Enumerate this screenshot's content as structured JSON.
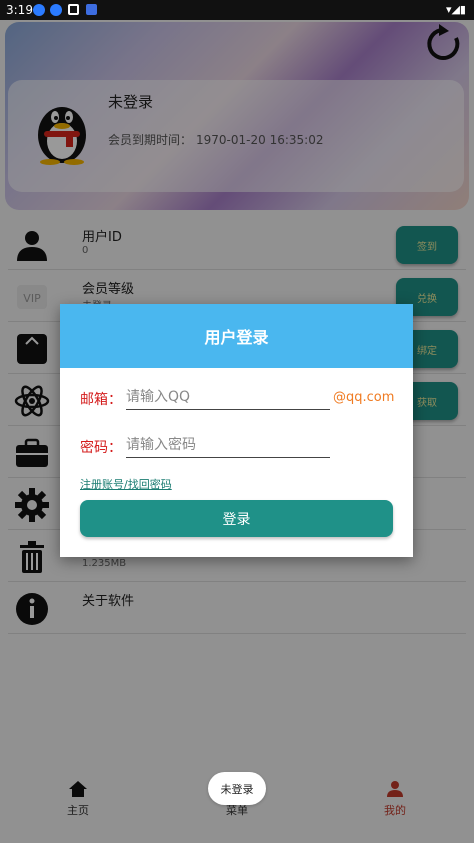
{
  "status_bar": {
    "time": "3:19"
  },
  "profile": {
    "username": "未登录",
    "vip_expiry_label": "会员到期时间：",
    "vip_expiry_value": "1970-01-20 16:35:02"
  },
  "list_items": [
    {
      "title": "用户ID",
      "subtitle": "0",
      "button": "签到",
      "icon": "user-icon"
    },
    {
      "title": "会员等级",
      "subtitle": "未登录",
      "button": "兑换",
      "icon": "vip-icon"
    },
    {
      "title": "",
      "subtitle": "",
      "button": "绑定",
      "icon": "box-icon"
    },
    {
      "title": "",
      "subtitle": "",
      "button": "获取",
      "icon": "atom-icon"
    },
    {
      "title": "",
      "subtitle": "",
      "button": "",
      "icon": "briefcase-icon"
    },
    {
      "title": "",
      "subtitle": "",
      "button": "",
      "icon": "gear-icon"
    },
    {
      "title": "",
      "subtitle": "1.235MB",
      "button": "",
      "icon": "trash-icon"
    },
    {
      "title": "关于软件",
      "subtitle": "",
      "button": "",
      "icon": "info-icon"
    }
  ],
  "dialog": {
    "title": "用户登录",
    "email_label": "邮箱：",
    "email_placeholder": "请输入QQ",
    "email_suffix": "@qq.com",
    "password_label": "密码：",
    "password_placeholder": "请输入密码",
    "register_link": "注册账号/找回密码",
    "login_button": "登录"
  },
  "bottom_nav": [
    {
      "label": "主页",
      "icon": "home-icon"
    },
    {
      "label": "菜单",
      "icon": "menu-icon"
    },
    {
      "label": "我的",
      "icon": "person-icon",
      "active": true
    }
  ],
  "toast": "未登录",
  "colors": {
    "accent": "#1f9188",
    "dialog_header": "#4ab7ef",
    "label_red": "#d41c1c",
    "suffix_orange": "#f07b22",
    "nav_active": "#c0392b"
  }
}
